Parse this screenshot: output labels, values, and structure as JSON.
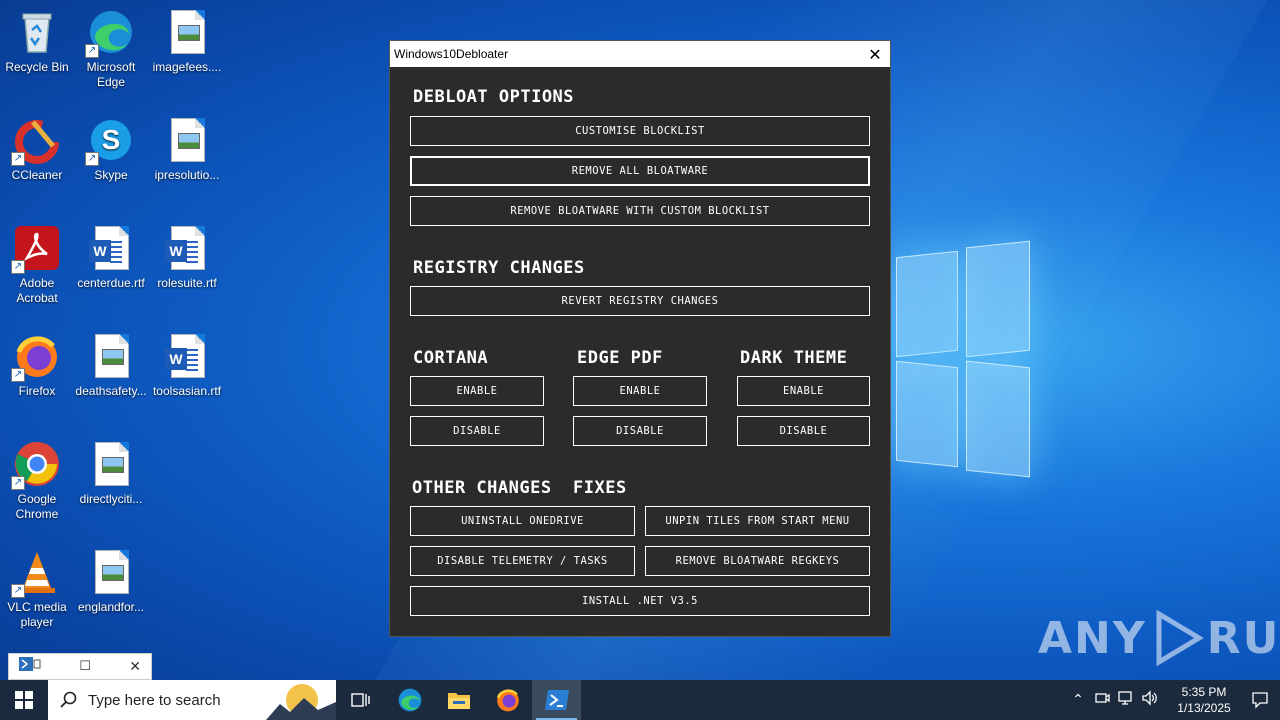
{
  "desktop": {
    "icons": [
      {
        "label": "Recycle Bin"
      },
      {
        "label": "Microsoft Edge"
      },
      {
        "label": "imagefees...."
      },
      {
        "label": "CCleaner"
      },
      {
        "label": "Skype"
      },
      {
        "label": "ipresolutio..."
      },
      {
        "label": "Adobe Acrobat"
      },
      {
        "label": "centerdue.rtf"
      },
      {
        "label": "rolesuite.rtf"
      },
      {
        "label": "Firefox"
      },
      {
        "label": "deathsafety..."
      },
      {
        "label": "toolsasian.rtf"
      },
      {
        "label": "Google Chrome"
      },
      {
        "label": "directlyciti..."
      },
      {
        "label": "VLC media player"
      },
      {
        "label": "englandfor..."
      }
    ]
  },
  "window": {
    "title": "Windows10Debloater",
    "close_symbol": "✕",
    "sections": {
      "debloat": "DEBLOAT OPTIONS",
      "registry": "REGISTRY CHANGES",
      "cortana": "CORTANA",
      "edge_pdf": "EDGE PDF",
      "dark_theme": "DARK THEME",
      "other": "OTHER CHANGES  FIXES"
    },
    "buttons": {
      "customise": "CUSTOMISE BLOCKLIST",
      "remove_all": "REMOVE ALL BLOATWARE",
      "remove_custom": "REMOVE BLOATWARE WITH CUSTOM BLOCKLIST",
      "revert_registry": "REVERT REGISTRY CHANGES",
      "enable": "ENABLE",
      "disable": "DISABLE",
      "uninstall_onedrive": "UNINSTALL ONEDRIVE",
      "unpin_tiles": "UNPIN TILES FROM START MENU",
      "disable_telemetry": "DISABLE TELEMETRY / TASKS",
      "remove_regkeys": "REMOVE BLOATWARE REGKEYS",
      "install_net": "INSTALL .NET V3.5"
    }
  },
  "taskbar": {
    "search_placeholder": "Type here to search",
    "time": "5:35 PM",
    "date": "1/13/2025"
  },
  "watermark": {
    "text_left": "ANY",
    "text_right": "RUN"
  },
  "colors": {
    "accent": "#0078d7",
    "window_bg": "#2b2b2b",
    "taskbar_bg": "#1b2a3c"
  }
}
